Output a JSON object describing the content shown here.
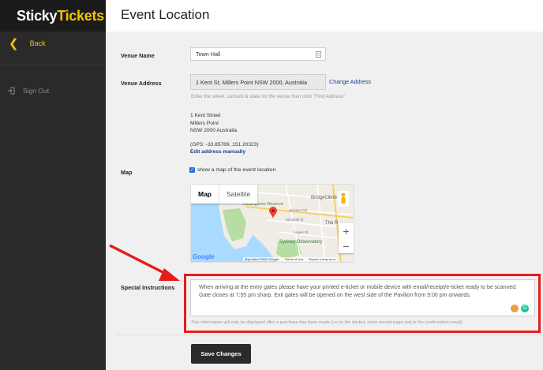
{
  "sidebar": {
    "logo_part1": "Sticky",
    "logo_part2": "Tickets",
    "back_label": "Back",
    "signout_label": "Sign Out"
  },
  "header": {
    "title": "Event Location"
  },
  "form": {
    "venue_name_label": "Venue Name",
    "venue_name_value": "Town Hall",
    "venue_address_label": "Venue Address",
    "venue_address_value": "1 Kent St, Millers Point NSW 2000, Australia",
    "change_address_link": "Change Address",
    "address_hint": "Enter the street, surburb & state for the venue then click \"Find Address\"",
    "address_line1": "1 Kent Street",
    "address_line2": "Millers Point",
    "address_line3": "NSW 2000 Australia",
    "gps": "(GPS: -33.85789, 151.20323)",
    "edit_manual_link": "Edit address manually",
    "map_label": "Map",
    "show_map_label": "show a map of the event location",
    "special_instructions_label": "Special Instructions",
    "special_instructions_value": "When arriving at the entry gates please have your printed e-ticket or mobile device with email/receipt/e-ticket ready to be scanned. Gate closes at 7:55 pm sharp. Exit gates will be opened on the west side of the Pavilion from 9:00 pm onwards.",
    "instructions_hint": "This information will only be displayed after a purchase has been made (i.e on the eticket, order receipt page and in the confirmation email)",
    "save_button": "Save Changes"
  },
  "map": {
    "tab_map": "Map",
    "tab_satellite": "Satellite",
    "place_bridgeclimb": "BridgeClimb",
    "place_barangaroo": "Barangaroo Reserve",
    "place_observatory": "Sydney Observatory",
    "place_rocks": "The R",
    "place_hickson": "Hickson Rd",
    "place_windmill": "Windmill St",
    "place_argyle": "Argyle St",
    "google_logo": "Google",
    "attribution": "Map data ©2020 Google",
    "terms": "Terms of Use",
    "report": "Report a map error",
    "zoom_in": "+",
    "zoom_out": "−"
  },
  "colors": {
    "accent": "#f5c400",
    "sidebar_bg": "#2a2a2a",
    "highlight_red": "#e61b1b",
    "link": "#1c3f8a"
  }
}
